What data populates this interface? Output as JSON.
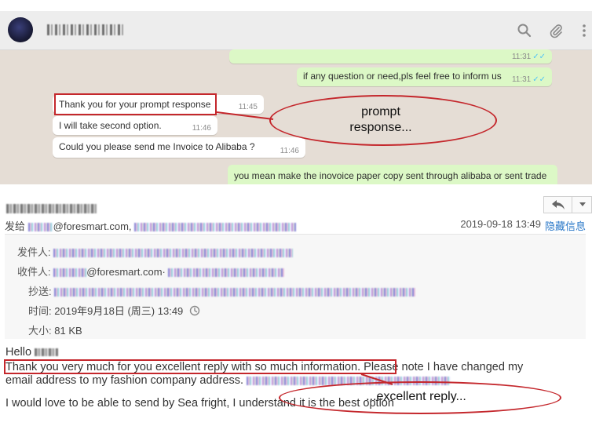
{
  "whatsapp": {
    "messages": [
      {
        "direction": "out",
        "text": "",
        "time": "11:31",
        "ticks": "✓✓"
      },
      {
        "direction": "out",
        "text": "if any question or need,pls feel free to inform us",
        "time": "11:31",
        "ticks": "✓✓"
      },
      {
        "direction": "in",
        "text": "Thank you for your prompt response",
        "time": "11:45"
      },
      {
        "direction": "in",
        "text": "I will take second option.",
        "time": "11:46"
      },
      {
        "direction": "in",
        "text": "Could you please send me Invoice to Alibaba ?",
        "time": "11:46"
      },
      {
        "direction": "out",
        "text": "you mean make the inovoice paper copy sent through alibaba or sent trade"
      }
    ],
    "icons": [
      "search-icon",
      "paperclip-icon",
      "more-vertical-icon"
    ]
  },
  "email": {
    "to_prefix": "发给",
    "to_domain": "@foresmart.com,",
    "date": "2019-09-18 13:49",
    "hide_info": "隐藏信息",
    "details": {
      "from_label": "发件人:",
      "recipient_label": "收件人:",
      "recipient_domain": "@foresmart.com·",
      "cc_label": "抄送:",
      "time_label": "时间:",
      "time_value": "2019年9月18日 (周三) 13:49",
      "size_label": "大小:",
      "size_value": "81 KB"
    },
    "body": {
      "greeting": "Hello",
      "line1_highlight": "Thank you very much for you excellent reply with so much information.",
      "line1_rest": " Please note I have changed my",
      "line2": "email address to my fashion company address.",
      "line3": "I would love to be able to send by Sea fright, I understand it is the best option"
    },
    "toolbar_icons": [
      "reply-icon",
      "chevron-down-icon"
    ]
  },
  "annotations": {
    "prompt_line1": "prompt",
    "prompt_line2": "response...",
    "excellent": "...excellent reply...",
    "color": "#c4272c"
  }
}
